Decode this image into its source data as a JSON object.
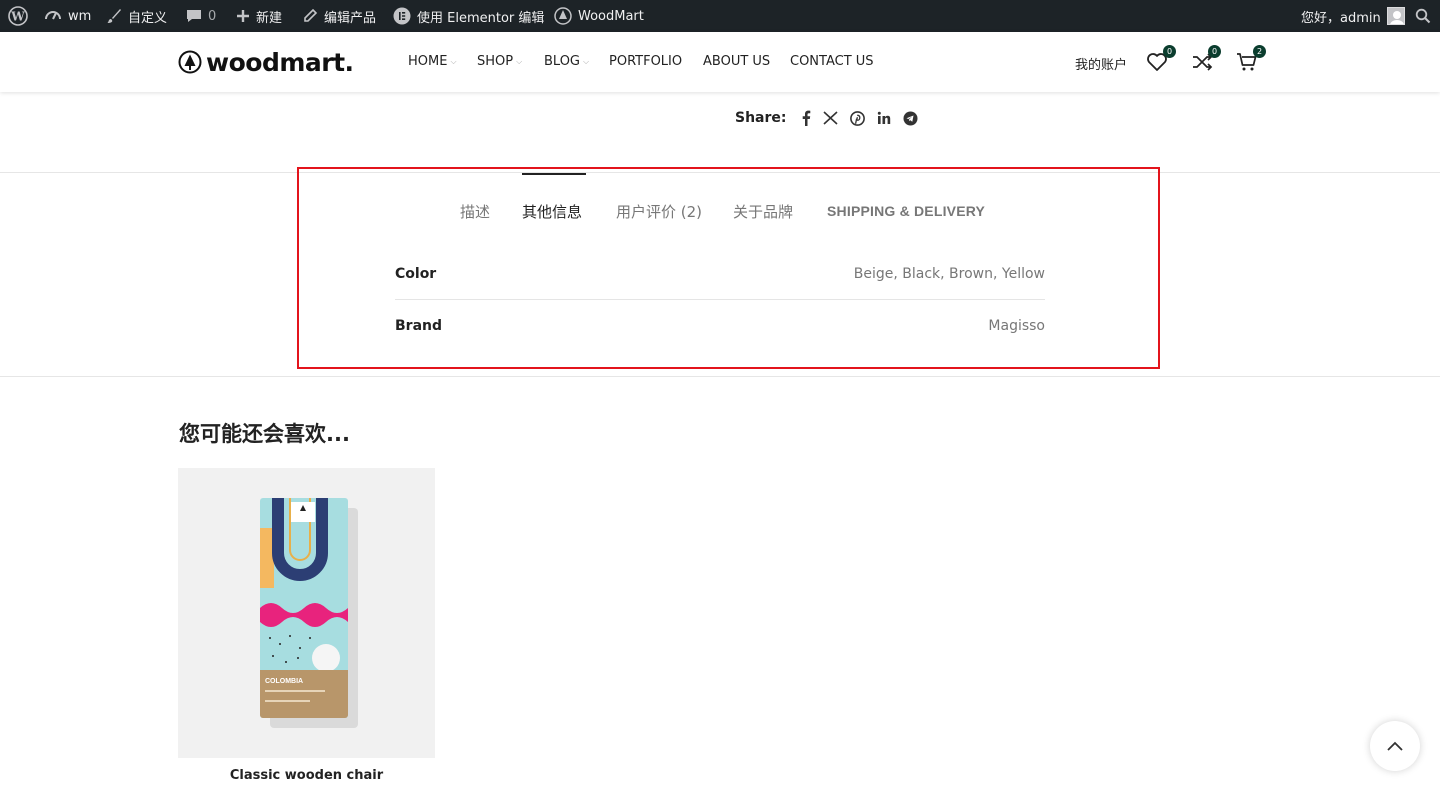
{
  "admin_bar": {
    "site_name": "wm",
    "customize": "自定义",
    "comments_count": "0",
    "new": "新建",
    "edit_product": "编辑产品",
    "elementor_edit": "使用 Elementor 编辑",
    "theme": "WoodMart",
    "greeting": "您好，admin"
  },
  "header": {
    "logo": "woodmart.",
    "nav": [
      "HOME",
      "SHOP",
      "BLOG",
      "PORTFOLIO",
      "ABOUT US",
      "CONTACT US"
    ],
    "account": "我的账户",
    "wishlist_count": "0",
    "compare_count": "0",
    "cart_count": "2"
  },
  "share": {
    "label": "Share:"
  },
  "tabs": {
    "items": [
      "描述",
      "其他信息",
      "用户评价 (2)",
      "关于品牌",
      "SHIPPING & DELIVERY"
    ],
    "active": "其他信息"
  },
  "attributes": [
    {
      "label": "Color",
      "value": "Beige, Black, Brown, Yellow"
    },
    {
      "label": "Brand",
      "value": "Magisso"
    }
  ],
  "related": {
    "title": "您可能还会喜欢...",
    "products": [
      {
        "name": "Classic wooden chair",
        "package_label": "COLOMBIA"
      }
    ]
  },
  "colors": {
    "admin_bar_bg": "#1d2327",
    "badge": "#0b3d2e",
    "highlight_box": "#e3141c"
  }
}
